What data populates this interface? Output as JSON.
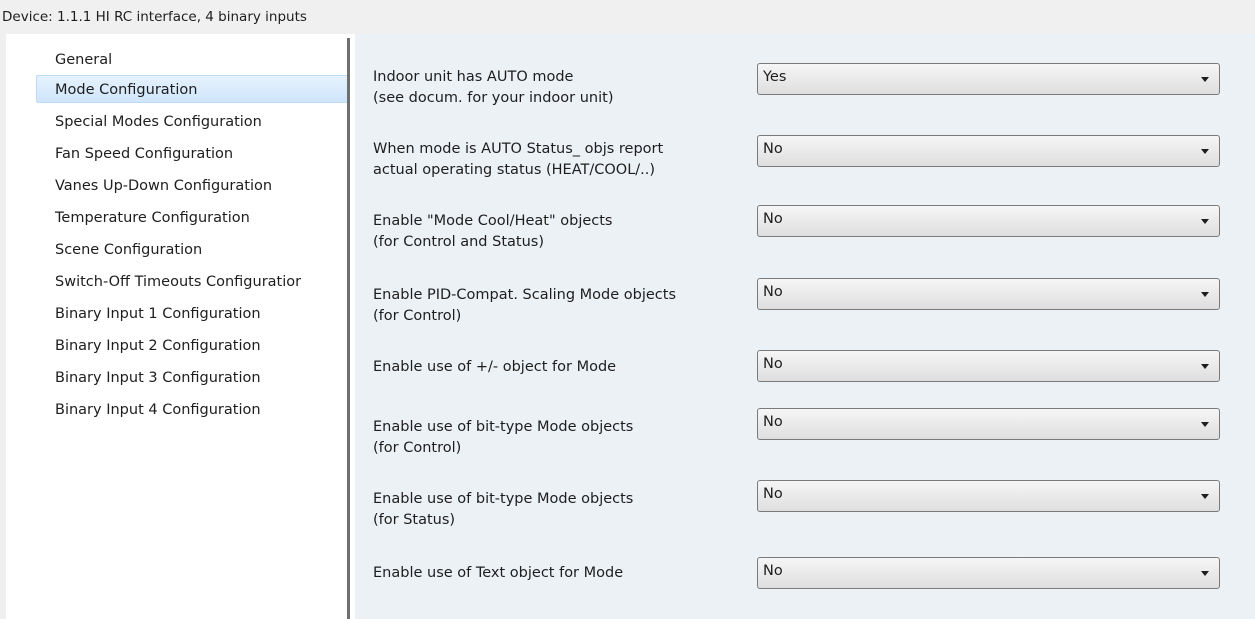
{
  "window": {
    "title": "Device: 1.1.1  HI RC interface, 4 binary inputs"
  },
  "sidebar": {
    "selected_index": 1,
    "items": [
      {
        "label": "General"
      },
      {
        "label": "Mode Configuration"
      },
      {
        "label": "Special Modes Configuration"
      },
      {
        "label": "Fan Speed Configuration"
      },
      {
        "label": "Vanes Up-Down Configuration"
      },
      {
        "label": "Temperature Configuration"
      },
      {
        "label": "Scene Configuration"
      },
      {
        "label": "Switch-Off Timeouts Configuratior"
      },
      {
        "label": "Binary Input 1 Configuration"
      },
      {
        "label": "Binary Input 2 Configuration"
      },
      {
        "label": "Binary Input 3 Configuration"
      },
      {
        "label": "Binary Input 4 Configuration"
      }
    ]
  },
  "parameters": [
    {
      "label_lines": [
        "Indoor unit has AUTO mode",
        "(see docum. for your indoor unit)"
      ],
      "value": "Yes"
    },
    {
      "label_lines": [
        "When mode is AUTO Status_ objs report",
        "actual operating status (HEAT/COOL/..)"
      ],
      "value": "No"
    },
    {
      "label_lines": [
        "Enable \"Mode Cool/Heat\" objects",
        "(for Control and Status)"
      ],
      "value": "No"
    },
    {
      "label_lines": [
        "Enable PID-Compat. Scaling Mode objects",
        "(for Control)"
      ],
      "value": "No"
    },
    {
      "label_lines": [
        "Enable use of +/- object for Mode"
      ],
      "value": "No"
    },
    {
      "label_lines": [
        "Enable use of bit-type Mode objects",
        "(for Control)"
      ],
      "value": "No"
    },
    {
      "label_lines": [
        "Enable use of bit-type Mode objects",
        "(for Status)"
      ],
      "value": "No"
    },
    {
      "label_lines": [
        "Enable use of Text object for Mode"
      ],
      "value": "No"
    }
  ],
  "icons": {
    "dropdown": "chevron-down-icon"
  }
}
